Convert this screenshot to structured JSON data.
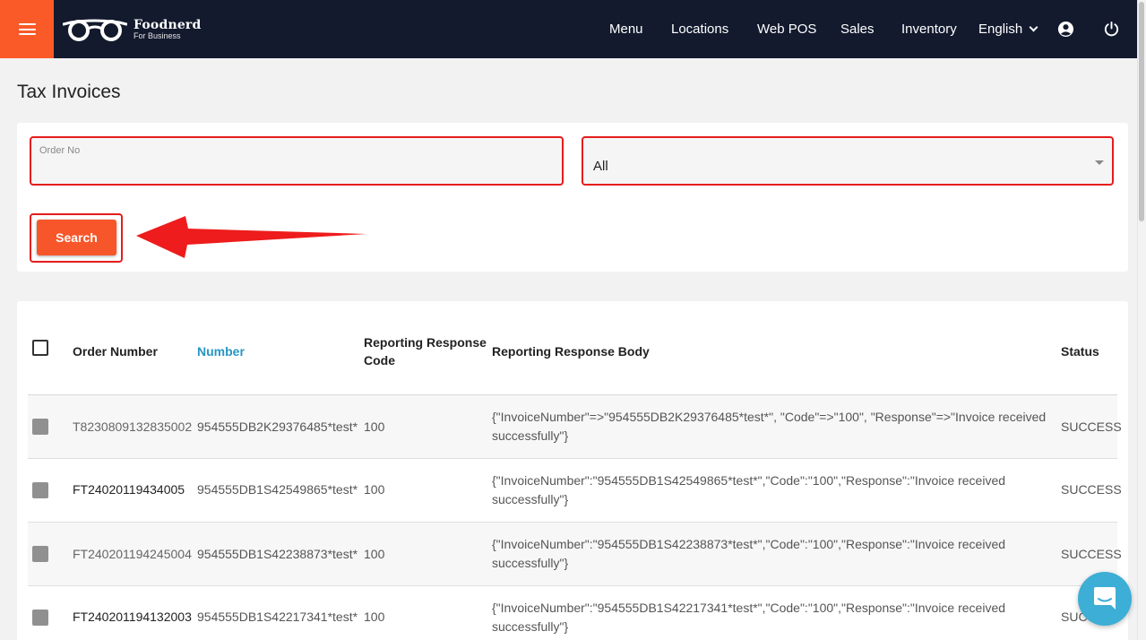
{
  "app": {
    "logo_name": "Foodnerd",
    "logo_sub": "For Business"
  },
  "nav": {
    "items": [
      "Menu",
      "Locations",
      "Web POS",
      "Sales",
      "Inventory"
    ],
    "language": "English"
  },
  "page": {
    "title": "Tax Invoices"
  },
  "filters": {
    "order_label": "Order No",
    "order_value": "",
    "status_value": "All",
    "search_label": "Search"
  },
  "table": {
    "columns": {
      "order_number": "Order Number",
      "number": "Number",
      "code_line1": "Reporting Response",
      "code_line2": "Code",
      "body": "Reporting Response Body",
      "status": "Status"
    },
    "rows": [
      {
        "order_number": "T8230809132835002",
        "number": "954555DB2K29376485*test*",
        "code": "100",
        "body": "{\"InvoiceNumber\"=>\"954555DB2K29376485*test*\", \"Code\"=>\"100\", \"Response\"=>\"Invoice received successfully\"}",
        "status": "SUCCESS"
      },
      {
        "order_number": "FT24020119434005",
        "number": "954555DB1S42549865*test*",
        "code": "100",
        "body": "{\"InvoiceNumber\":\"954555DB1S42549865*test*\",\"Code\":\"100\",\"Response\":\"Invoice received successfully\"}",
        "status": "SUCCESS"
      },
      {
        "order_number": "FT240201194245004",
        "number": "954555DB1S42238873*test*",
        "code": "100",
        "body": "{\"InvoiceNumber\":\"954555DB1S42238873*test*\",\"Code\":\"100\",\"Response\":\"Invoice received successfully\"}",
        "status": "SUCCESS"
      },
      {
        "order_number": "FT240201194132003",
        "number": "954555DB1S42217341*test*",
        "code": "100",
        "body": "{\"InvoiceNumber\":\"954555DB1S42217341*test*\",\"Code\":\"100\",\"Response\":\"Invoice received successfully\"}",
        "status": "SUCC"
      }
    ]
  },
  "colors": {
    "accent": "#fa5a28",
    "navbar": "#131a2e",
    "highlight": "#e51c1c",
    "sorted_column": "#2795c4",
    "chat": "#3daed5"
  },
  "icons": [
    "hamburger-icon",
    "glasses-logo-icon",
    "chevron-down-icon",
    "user-circle-icon",
    "power-icon",
    "caret-down-icon",
    "chat-icon",
    "red-arrow-annotation"
  ]
}
